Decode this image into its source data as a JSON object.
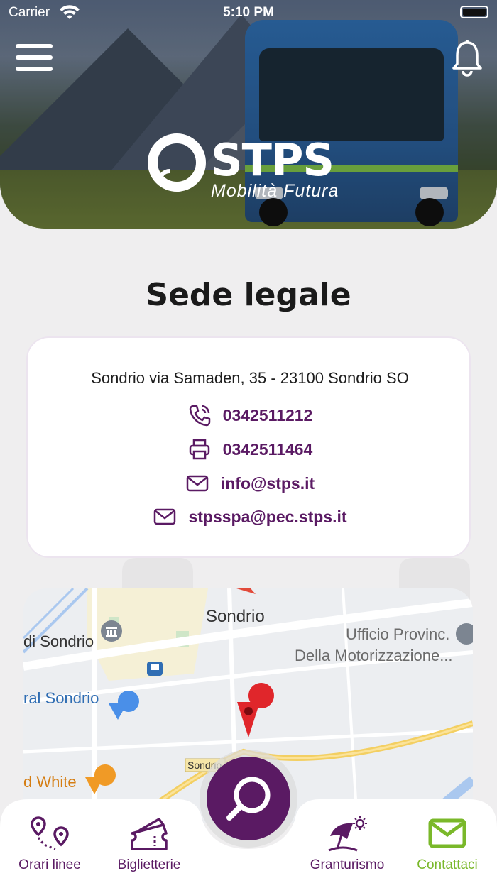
{
  "status_bar": {
    "carrier": "Carrier",
    "time": "5:10 PM"
  },
  "header": {
    "brand": "STPS",
    "tagline": "Mobilità Futura"
  },
  "section": {
    "title": "Sede legale"
  },
  "contact": {
    "address": "Sondrio via Samaden, 35 - 23100 Sondrio SO",
    "phone": "0342511212",
    "fax": "0342511464",
    "email": "info@stps.it",
    "pec": "stpsspa@pec.stps.it"
  },
  "map": {
    "labels": {
      "city": "Sondrio",
      "left_top": "di Sondrio",
      "right_line1": "Ufficio Provinc.",
      "right_line2": "Della Motorizzazione...",
      "left_mid": "ral Sondrio",
      "road": "Sondrio",
      "left_bottom": "d White"
    }
  },
  "tabs": [
    {
      "label": "Orari linee",
      "icon": "route-pins-icon"
    },
    {
      "label": "Biglietterie",
      "icon": "ticket-icon"
    },
    {
      "label": "Granturismo",
      "icon": "beach-umbrella-icon"
    },
    {
      "label": "Contattaci",
      "icon": "envelope-icon"
    }
  ],
  "colors": {
    "brand_purple": "#5a1a63",
    "active_green": "#7ab82a",
    "background": "#efeeef"
  }
}
